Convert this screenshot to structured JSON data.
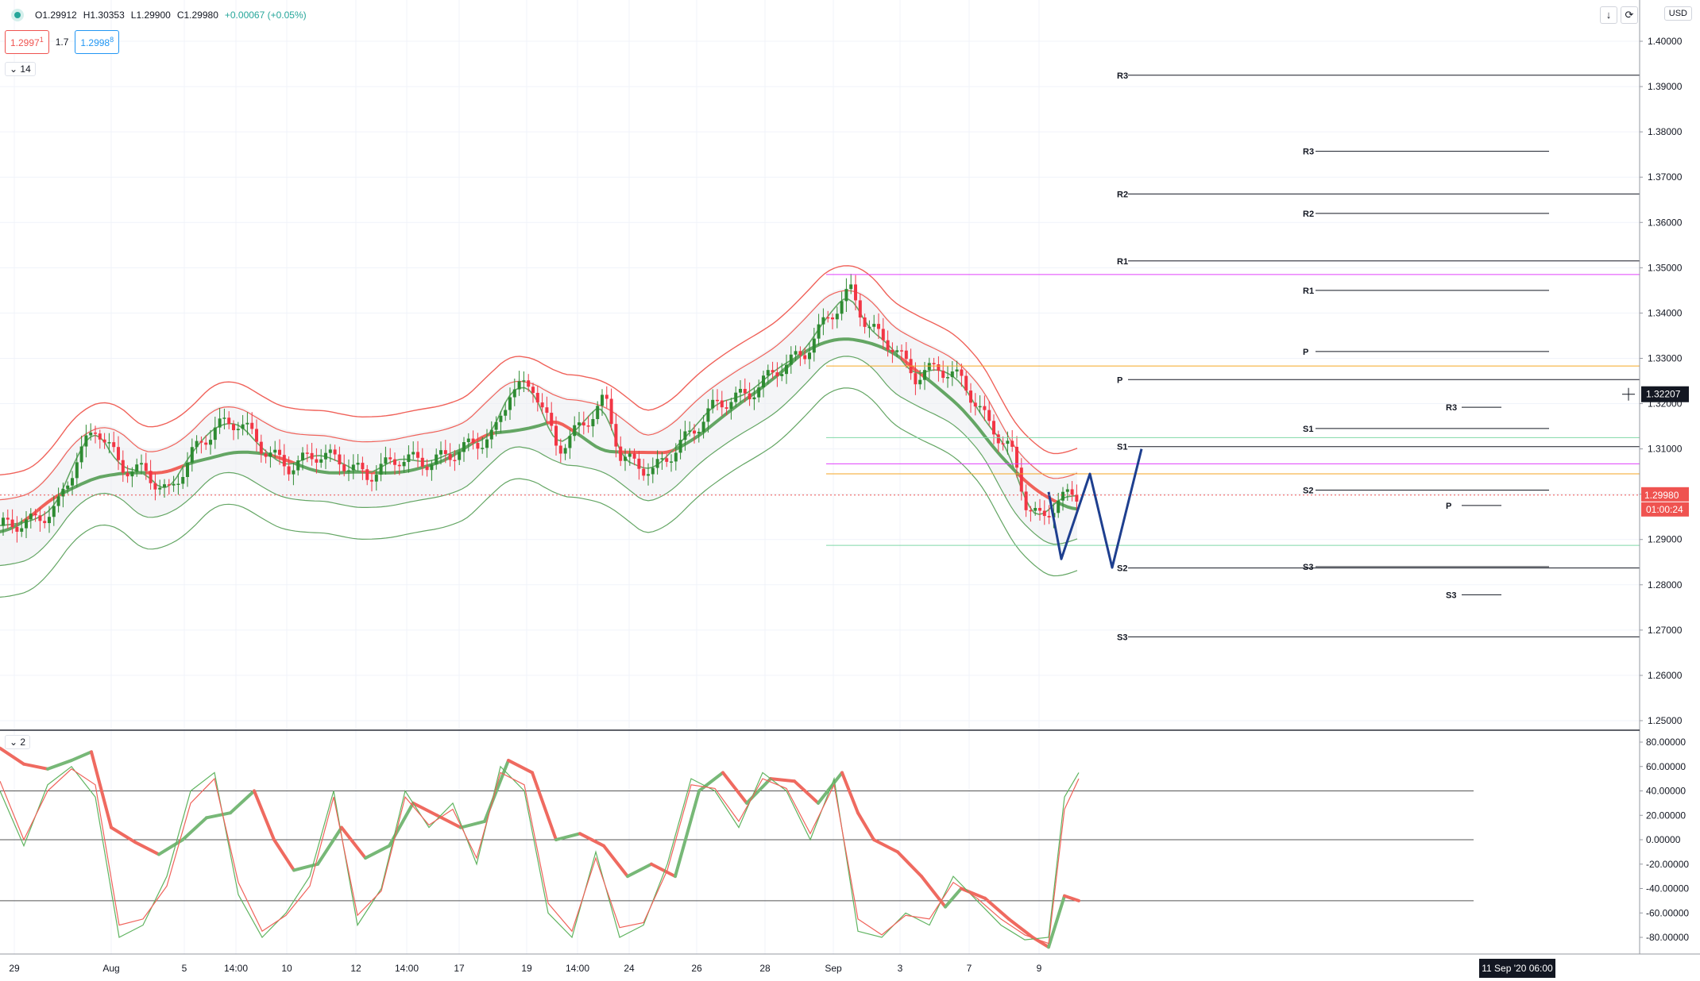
{
  "header": {
    "open": "O1.29912",
    "high": "H1.30353",
    "low": "L1.29900",
    "close": "C1.29980",
    "change": "+0.00067 (+0.05%)",
    "sell_price": "1.2997",
    "sell_price_sup": "1",
    "spread": "1.7",
    "buy_price": "1.2998",
    "buy_price_sup": "8",
    "main_period": "14",
    "osc_period": "2",
    "currency": "USD"
  },
  "colors": {
    "up": "#2e8b32",
    "down": "#f23645",
    "env_green": "#64a664",
    "env_red": "#f0625a",
    "forecast": "#1e3f8f",
    "pivot_line": "#131722",
    "orange": "#f5a623",
    "magenta": "#e040fb",
    "teal": "#7fd8a6",
    "last_price": "#ef5350"
  },
  "chart_data": [
    {
      "type": "candlestick",
      "panel": "price",
      "ylim": [
        1.245,
        1.405
      ],
      "y_ticks": [
        "1.40000",
        "1.39000",
        "1.38000",
        "1.37000",
        "1.36000",
        "1.35000",
        "1.34000",
        "1.33000",
        "1.32000",
        "1.31000",
        "1.30000",
        "1.29000",
        "1.28000",
        "1.27000",
        "1.26000",
        "1.25000"
      ],
      "x_ticks": [
        "29",
        "Aug",
        "5",
        "14:00",
        "10",
        "12",
        "14:00",
        "17",
        "19",
        "14:00",
        "24",
        "26",
        "28",
        "Sep",
        "3",
        "7",
        "9"
      ],
      "x_tick_pos": [
        18,
        140,
        232,
        297,
        361,
        448,
        512,
        578,
        663,
        727,
        792,
        877,
        963,
        1049,
        1133,
        1220,
        1308
      ],
      "pair_close_curve": [
        [
          0,
          1.293
        ],
        [
          40,
          1.294
        ],
        [
          70,
          1.297
        ],
        [
          95,
          1.308
        ],
        [
          120,
          1.315
        ],
        [
          150,
          1.306
        ],
        [
          180,
          1.305
        ],
        [
          210,
          1.3
        ],
        [
          240,
          1.309
        ],
        [
          270,
          1.315
        ],
        [
          300,
          1.316
        ],
        [
          330,
          1.31
        ],
        [
          360,
          1.306
        ],
        [
          400,
          1.309
        ],
        [
          430,
          1.307
        ],
        [
          460,
          1.304
        ],
        [
          500,
          1.308
        ],
        [
          540,
          1.307
        ],
        [
          580,
          1.31
        ],
        [
          620,
          1.313
        ],
        [
          640,
          1.323
        ],
        [
          670,
          1.324
        ],
        [
          700,
          1.31
        ],
        [
          730,
          1.315
        ],
        [
          760,
          1.321
        ],
        [
          780,
          1.308
        ],
        [
          820,
          1.305
        ],
        [
          860,
          1.312
        ],
        [
          900,
          1.32
        ],
        [
          940,
          1.322
        ],
        [
          980,
          1.328
        ],
        [
          1010,
          1.331
        ],
        [
          1040,
          1.339
        ],
        [
          1070,
          1.345
        ],
        [
          1090,
          1.337
        ],
        [
          1120,
          1.333
        ],
        [
          1150,
          1.326
        ],
        [
          1180,
          1.328
        ],
        [
          1210,
          1.325
        ],
        [
          1240,
          1.316
        ],
        [
          1270,
          1.31
        ],
        [
          1290,
          1.298
        ],
        [
          1310,
          1.294
        ],
        [
          1330,
          1.299
        ],
        [
          1355,
          1.2998
        ]
      ],
      "last_price": "1.29980",
      "countdown": "01:00:24",
      "crosshair_price": "1.32207",
      "crosshair_date": "11 Sep '20",
      "crosshair_time": "06:00",
      "pivots_monthly": [
        {
          "label": "R3",
          "value": 1.3925
        },
        {
          "label": "R2",
          "value": 1.3663
        },
        {
          "label": "R1",
          "value": 1.3515
        },
        {
          "label": "P",
          "value": 1.3253
        },
        {
          "label": "S1",
          "value": 1.3105
        },
        {
          "label": "S2",
          "value": 1.2837
        },
        {
          "label": "S3",
          "value": 1.2685
        }
      ],
      "pivots_weekly": [
        {
          "label": "R3",
          "value": 1.3757
        },
        {
          "label": "R2",
          "value": 1.362
        },
        {
          "label": "R1",
          "value": 1.345
        },
        {
          "label": "P",
          "value": 1.3315
        },
        {
          "label": "S1",
          "value": 1.3145
        },
        {
          "label": "S2",
          "value": 1.3009
        },
        {
          "label": "S3",
          "value": 1.284
        }
      ],
      "pivots_daily": [
        {
          "label": "R3",
          "value": 1.3192
        },
        {
          "label": "P",
          "value": 1.2975
        },
        {
          "label": "S3",
          "value": 1.2778
        }
      ],
      "horizontal_lines": [
        {
          "value": 1.3485,
          "color": "magenta"
        },
        {
          "value": 1.3283,
          "color": "orange"
        },
        {
          "value": 1.3125,
          "color": "teal"
        },
        {
          "value": 1.3067,
          "color": "magenta"
        },
        {
          "value": 1.3045,
          "color": "orange"
        },
        {
          "value": 1.2887,
          "color": "teal"
        }
      ],
      "forecast_path": [
        [
          1320,
          1.3005
        ],
        [
          1336,
          1.2857
        ],
        [
          1372,
          1.3045
        ],
        [
          1400,
          1.2838
        ],
        [
          1437,
          1.31
        ]
      ]
    },
    {
      "type": "line",
      "panel": "oscillator",
      "ylim": [
        -92,
        88
      ],
      "y_ticks": [
        "80.00000",
        "60.00000",
        "40.00000",
        "20.00000",
        "0.00000",
        "-20.00000",
        "-40.00000",
        "-60.00000",
        "-80.00000"
      ],
      "levels": [
        40,
        0,
        -50
      ],
      "series": [
        {
          "values": [
            [
              0,
              75
            ],
            [
              30,
              62
            ],
            [
              60,
              58
            ],
            [
              90,
              65
            ],
            [
              115,
              72
            ],
            [
              140,
              10
            ],
            [
              170,
              -2
            ],
            [
              200,
              -12
            ],
            [
              230,
              0
            ],
            [
              260,
              18
            ],
            [
              290,
              22
            ],
            [
              320,
              40
            ],
            [
              345,
              0
            ],
            [
              370,
              -25
            ],
            [
              400,
              -20
            ],
            [
              430,
              10
            ],
            [
              460,
              -15
            ],
            [
              490,
              -5
            ],
            [
              520,
              30
            ],
            [
              550,
              20
            ],
            [
              580,
              10
            ],
            [
              610,
              15
            ],
            [
              640,
              65
            ],
            [
              670,
              55
            ],
            [
              700,
              0
            ],
            [
              730,
              5
            ],
            [
              760,
              -5
            ],
            [
              790,
              -30
            ],
            [
              820,
              -20
            ],
            [
              850,
              -30
            ],
            [
              880,
              40
            ],
            [
              910,
              55
            ],
            [
              940,
              30
            ],
            [
              970,
              50
            ],
            [
              1000,
              48
            ],
            [
              1030,
              30
            ],
            [
              1060,
              55
            ],
            [
              1080,
              22
            ],
            [
              1100,
              0
            ],
            [
              1130,
              -10
            ],
            [
              1160,
              -30
            ],
            [
              1190,
              -55
            ],
            [
              1210,
              -40
            ],
            [
              1240,
              -48
            ],
            [
              1270,
              -65
            ],
            [
              1300,
              -80
            ],
            [
              1320,
              -88
            ],
            [
              1340,
              -46
            ],
            [
              1358,
              -50
            ]
          ]
        },
        {
          "values": [
            [
              0,
              40
            ],
            [
              30,
              -5
            ],
            [
              60,
              45
            ],
            [
              90,
              60
            ],
            [
              120,
              35
            ],
            [
              150,
              -80
            ],
            [
              180,
              -70
            ],
            [
              210,
              -30
            ],
            [
              240,
              40
            ],
            [
              270,
              55
            ],
            [
              300,
              -45
            ],
            [
              330,
              -80
            ],
            [
              360,
              -60
            ],
            [
              390,
              -30
            ],
            [
              420,
              40
            ],
            [
              450,
              -70
            ],
            [
              480,
              -40
            ],
            [
              510,
              40
            ],
            [
              540,
              10
            ],
            [
              570,
              30
            ],
            [
              600,
              -20
            ],
            [
              630,
              60
            ],
            [
              660,
              40
            ],
            [
              690,
              -60
            ],
            [
              720,
              -80
            ],
            [
              750,
              -10
            ],
            [
              780,
              -80
            ],
            [
              810,
              -70
            ],
            [
              840,
              -20
            ],
            [
              870,
              50
            ],
            [
              900,
              40
            ],
            [
              930,
              10
            ],
            [
              960,
              55
            ],
            [
              990,
              40
            ],
            [
              1020,
              0
            ],
            [
              1050,
              50
            ],
            [
              1080,
              -75
            ],
            [
              1110,
              -80
            ],
            [
              1140,
              -60
            ],
            [
              1170,
              -70
            ],
            [
              1200,
              -30
            ],
            [
              1230,
              -50
            ],
            [
              1260,
              -70
            ],
            [
              1290,
              -82
            ],
            [
              1320,
              -80
            ],
            [
              1340,
              35
            ],
            [
              1358,
              55
            ]
          ]
        },
        {
          "values": [
            [
              0,
              48
            ],
            [
              30,
              0
            ],
            [
              60,
              40
            ],
            [
              90,
              58
            ],
            [
              120,
              45
            ],
            [
              150,
              -70
            ],
            [
              180,
              -65
            ],
            [
              210,
              -38
            ],
            [
              240,
              30
            ],
            [
              270,
              50
            ],
            [
              300,
              -35
            ],
            [
              330,
              -75
            ],
            [
              360,
              -62
            ],
            [
              390,
              -38
            ],
            [
              420,
              35
            ],
            [
              450,
              -62
            ],
            [
              480,
              -42
            ],
            [
              510,
              35
            ],
            [
              540,
              12
            ],
            [
              570,
              25
            ],
            [
              600,
              -15
            ],
            [
              630,
              55
            ],
            [
              660,
              45
            ],
            [
              690,
              -52
            ],
            [
              720,
              -75
            ],
            [
              750,
              -15
            ],
            [
              780,
              -72
            ],
            [
              810,
              -68
            ],
            [
              840,
              -25
            ],
            [
              870,
              45
            ],
            [
              900,
              42
            ],
            [
              930,
              15
            ],
            [
              960,
              50
            ],
            [
              990,
              42
            ],
            [
              1020,
              5
            ],
            [
              1050,
              45
            ],
            [
              1080,
              -65
            ],
            [
              1110,
              -78
            ],
            [
              1140,
              -62
            ],
            [
              1170,
              -65
            ],
            [
              1200,
              -35
            ],
            [
              1230,
              -48
            ],
            [
              1260,
              -65
            ],
            [
              1290,
              -78
            ],
            [
              1320,
              -85
            ],
            [
              1340,
              25
            ],
            [
              1358,
              50
            ]
          ]
        }
      ]
    }
  ]
}
